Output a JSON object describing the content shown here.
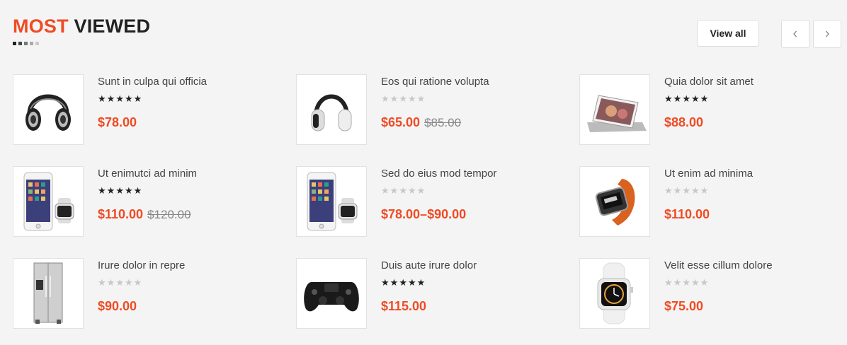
{
  "section": {
    "title_accent": "MOST",
    "title_rest": "VIEWED",
    "view_all_label": "View all",
    "prev_icon": "chevron-left-icon",
    "next_icon": "chevron-right-icon"
  },
  "colors": {
    "accent": "#f04b24",
    "dark": "#222222",
    "star_off": "#c8c8c8"
  },
  "products": [
    {
      "name": "Sunt in culpa qui officia",
      "rating": 5,
      "price": "$78.00",
      "old_price": "",
      "image": "headphones-black-icon"
    },
    {
      "name": "Eos qui ratione volupta",
      "rating": 0,
      "price": "$65.00",
      "old_price": "$85.00",
      "image": "headphones-white-icon"
    },
    {
      "name": "Quia dolor sit amet",
      "rating": 5,
      "price": "$88.00",
      "old_price": "",
      "image": "tablet-stand-icon"
    },
    {
      "name": "Ut enimutci ad minim",
      "rating": 5,
      "price": "$110.00",
      "old_price": "$120.00",
      "image": "phone-watch-icon"
    },
    {
      "name": "Sed do eius mod tempor",
      "rating": 0,
      "price": "$78.00–$90.00",
      "old_price": "",
      "image": "phone-watch-icon"
    },
    {
      "name": "Ut enim ad minima",
      "rating": 0,
      "price": "$110.00",
      "old_price": "",
      "image": "orange-watch-icon"
    },
    {
      "name": "Irure dolor in repre",
      "rating": 0,
      "price": "$90.00",
      "old_price": "",
      "image": "fridge-icon"
    },
    {
      "name": "Duis aute irure dolor",
      "rating": 5,
      "price": "$115.00",
      "old_price": "",
      "image": "gamepad-icon"
    },
    {
      "name": "Velit esse cillum dolore",
      "rating": 0,
      "price": "$75.00",
      "old_price": "",
      "image": "white-watch-icon"
    }
  ]
}
